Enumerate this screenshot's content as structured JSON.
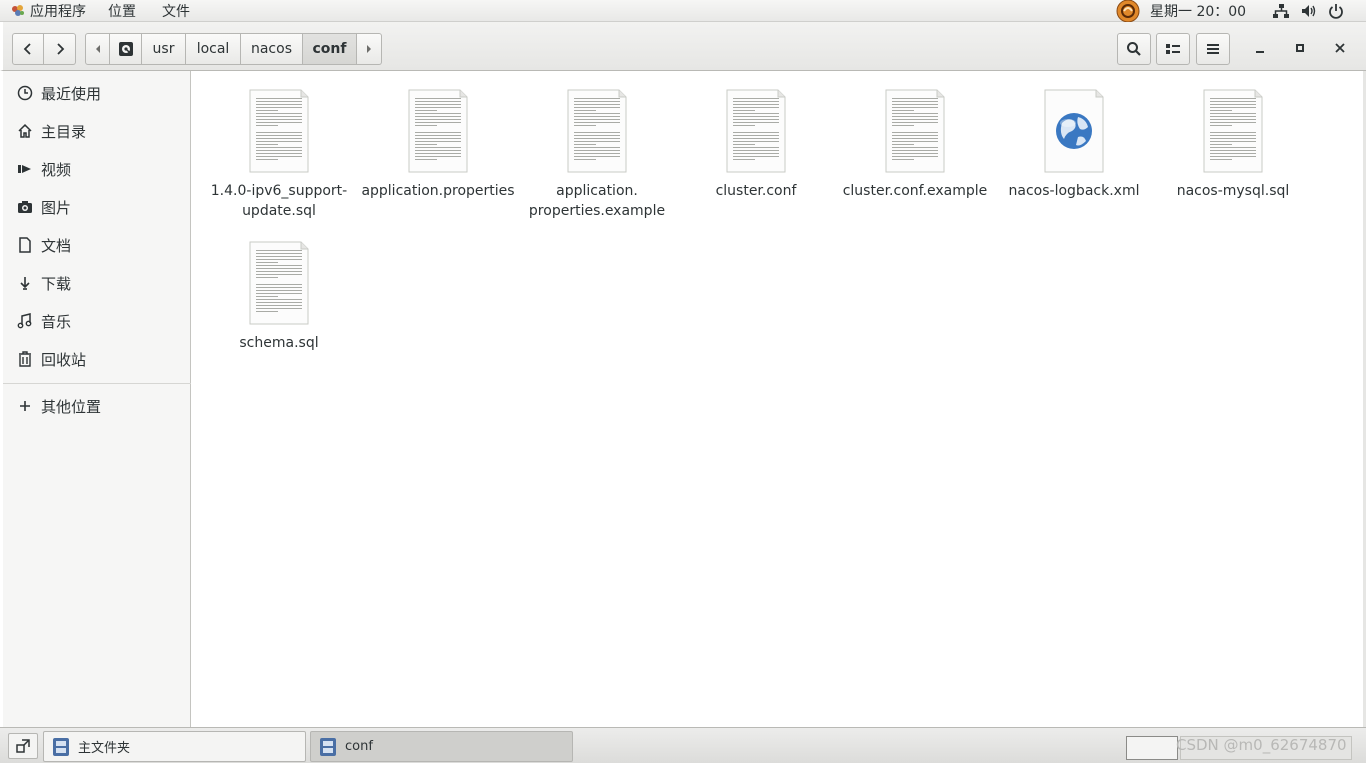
{
  "topbar": {
    "menus": [
      "应用程序",
      "位置",
      "文件"
    ],
    "clock": "星期一 20：00"
  },
  "headerbar": {
    "path": [
      "usr",
      "local",
      "nacos",
      "conf"
    ],
    "active_path": "conf"
  },
  "sidebar": {
    "items": [
      {
        "label": "最近使用",
        "icon": "clock-icon"
      },
      {
        "label": "主目录",
        "icon": "home-icon"
      },
      {
        "label": "视频",
        "icon": "video-icon"
      },
      {
        "label": "图片",
        "icon": "camera-icon"
      },
      {
        "label": "文档",
        "icon": "document-icon"
      },
      {
        "label": "下载",
        "icon": "download-icon"
      },
      {
        "label": "音乐",
        "icon": "music-icon"
      },
      {
        "label": "回收站",
        "icon": "trash-icon"
      }
    ],
    "other_locations": "其他位置"
  },
  "files": [
    {
      "name": "1.4.0-ipv6_support-update.sql",
      "icon": "text-file-icon",
      "lines": [
        "1.4.0-ipv6_support-",
        "update.sql"
      ]
    },
    {
      "name": "application.properties",
      "icon": "text-file-icon",
      "lines": [
        "application.properties"
      ]
    },
    {
      "name": "application.properties.example",
      "icon": "text-file-icon",
      "lines": [
        "application.",
        "properties.example"
      ]
    },
    {
      "name": "cluster.conf",
      "icon": "text-file-icon",
      "lines": [
        "cluster.conf"
      ]
    },
    {
      "name": "cluster.conf.example",
      "icon": "text-file-icon",
      "lines": [
        "cluster.conf.example"
      ]
    },
    {
      "name": "nacos-logback.xml",
      "icon": "globe-file-icon",
      "lines": [
        "nacos-logback.xml"
      ]
    },
    {
      "name": "nacos-mysql.sql",
      "icon": "text-file-icon",
      "lines": [
        "nacos-mysql.sql"
      ]
    },
    {
      "name": "schema.sql",
      "icon": "text-file-icon",
      "lines": [
        "schema.sql"
      ]
    }
  ],
  "taskbar": {
    "tasks": [
      {
        "label": "主文件夹",
        "active": false
      },
      {
        "label": "conf",
        "active": true
      }
    ],
    "watermark": "CSDN @m0_62674870"
  }
}
